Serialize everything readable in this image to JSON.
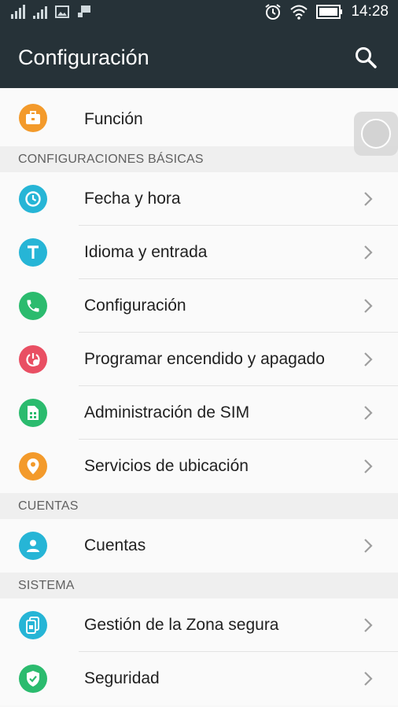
{
  "status_bar": {
    "time": "14:28"
  },
  "app_bar": {
    "title": "Configuración"
  },
  "top_item": {
    "label": "Función",
    "icon": "briefcase-icon",
    "color": "#f39a2b"
  },
  "sections": {
    "basic": "CONFIGURACIONES BÁSICAS",
    "accounts": "CUENTAS",
    "system": "SISTEMA"
  },
  "basic_items": [
    {
      "label": "Fecha y hora",
      "icon": "clock-icon",
      "color": "#26b5d6"
    },
    {
      "label": "Idioma y entrada",
      "icon": "language-t-icon",
      "color": "#26b5d6"
    },
    {
      "label": "Configuración",
      "icon": "phone-icon",
      "color": "#2bbb6e"
    },
    {
      "label": "Programar encendido y apagado",
      "icon": "power-schedule-icon",
      "color": "#e94f63"
    },
    {
      "label": "Administración de SIM",
      "icon": "sim-card-icon",
      "color": "#2bbb6e"
    },
    {
      "label": "Servicios de ubicación",
      "icon": "location-pin-icon",
      "color": "#f39a2b"
    }
  ],
  "account_items": [
    {
      "label": "Cuentas",
      "icon": "person-icon",
      "color": "#26b5d6"
    }
  ],
  "system_items": [
    {
      "label": "Gestión de la Zona segura",
      "icon": "secure-zone-icon",
      "color": "#26b5d6"
    },
    {
      "label": "Seguridad",
      "icon": "shield-icon",
      "color": "#2bbb6e"
    }
  ]
}
